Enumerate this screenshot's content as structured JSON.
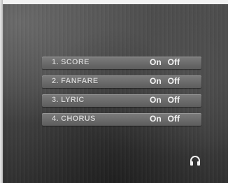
{
  "menu": {
    "items": [
      {
        "label": "1. SCORE",
        "on_label": "On",
        "off_label": "Off"
      },
      {
        "label": "2. FANFARE",
        "on_label": "On",
        "off_label": "Off"
      },
      {
        "label": "3. LYRIC",
        "on_label": "On",
        "off_label": "Off"
      },
      {
        "label": "4. CHORUS",
        "on_label": "On",
        "off_label": "Off"
      }
    ]
  },
  "icons": {
    "corner_icon": "headphone-icon"
  }
}
